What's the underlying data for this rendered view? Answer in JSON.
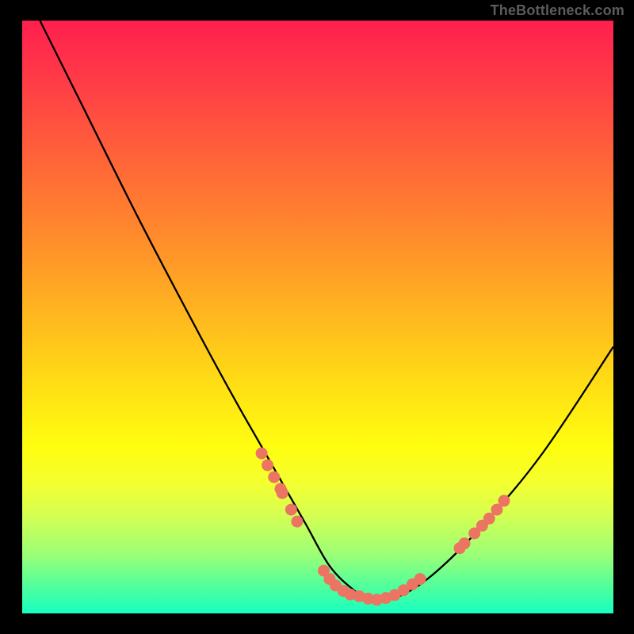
{
  "watermark": "TheBottleneck.com",
  "chart_data": {
    "type": "line",
    "title": "",
    "xlabel": "",
    "ylabel": "",
    "xlim": [
      0,
      100
    ],
    "ylim": [
      0,
      100
    ],
    "series": [
      {
        "name": "bottleneck-curve",
        "x": [
          3,
          10,
          20,
          30,
          36,
          40,
          44,
          48,
          52,
          56,
          58,
          60,
          64,
          70,
          78,
          88,
          100
        ],
        "y": [
          100,
          86,
          66,
          47,
          36,
          29,
          22,
          15,
          8,
          4,
          3,
          2.5,
          3,
          7,
          15,
          27,
          45
        ]
      }
    ],
    "dot_clusters": [
      {
        "name": "left-cluster",
        "points": [
          {
            "x": 40.5,
            "y": 27
          },
          {
            "x": 41.5,
            "y": 25
          },
          {
            "x": 42.6,
            "y": 23
          },
          {
            "x": 43.7,
            "y": 21
          },
          {
            "x": 44.0,
            "y": 20.3
          },
          {
            "x": 45.5,
            "y": 17.5
          },
          {
            "x": 46.5,
            "y": 15.5
          }
        ]
      },
      {
        "name": "bottom-cluster",
        "points": [
          {
            "x": 51.0,
            "y": 7.2
          },
          {
            "x": 52.0,
            "y": 5.8
          },
          {
            "x": 53.0,
            "y": 4.7
          },
          {
            "x": 54.3,
            "y": 3.8
          },
          {
            "x": 55.5,
            "y": 3.2
          },
          {
            "x": 57.0,
            "y": 2.9
          },
          {
            "x": 58.5,
            "y": 2.5
          },
          {
            "x": 60.0,
            "y": 2.3
          },
          {
            "x": 61.5,
            "y": 2.6
          },
          {
            "x": 63.0,
            "y": 3.1
          },
          {
            "x": 64.5,
            "y": 3.9
          },
          {
            "x": 66.0,
            "y": 4.9
          },
          {
            "x": 67.3,
            "y": 5.8
          }
        ]
      },
      {
        "name": "right-cluster",
        "points": [
          {
            "x": 74.0,
            "y": 11.0
          },
          {
            "x": 74.8,
            "y": 11.8
          },
          {
            "x": 76.5,
            "y": 13.5
          },
          {
            "x": 77.8,
            "y": 14.8
          },
          {
            "x": 79.0,
            "y": 16.0
          },
          {
            "x": 80.3,
            "y": 17.5
          },
          {
            "x": 81.5,
            "y": 19.0
          }
        ]
      }
    ],
    "colors": {
      "curve": "#000000",
      "dots": "#eb7562"
    }
  }
}
